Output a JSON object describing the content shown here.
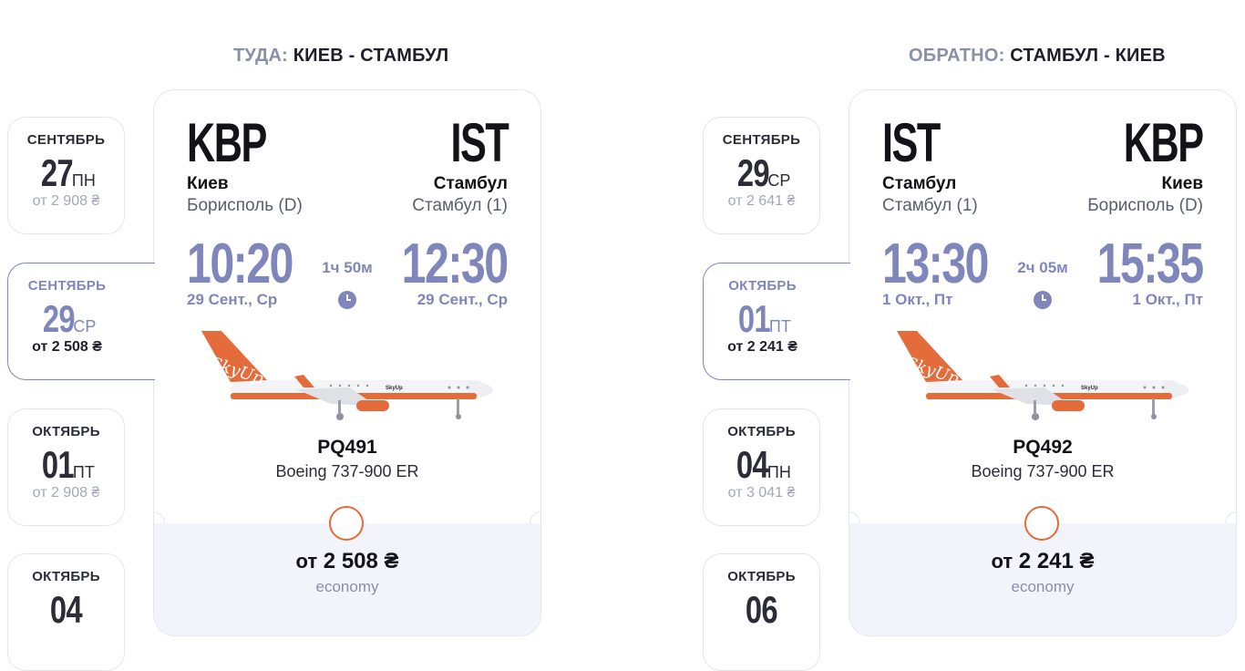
{
  "outbound": {
    "title_prefix": "ТУДА:",
    "title_route": "КИЕВ - СТАМБУЛ",
    "dates": [
      {
        "month": "СЕНТЯБРЬ",
        "day": "27",
        "weekday": "ПН",
        "price": "от 2 908 ₴",
        "active": false
      },
      {
        "month": "СЕНТЯБРЬ",
        "day": "29",
        "weekday": "СР",
        "price": "от 2 508 ₴",
        "active": true
      },
      {
        "month": "ОКТЯБРЬ",
        "day": "01",
        "weekday": "ПТ",
        "price": "от 2 908 ₴",
        "active": false
      },
      {
        "month": "ОКТЯБРЬ",
        "day": "04",
        "weekday": "",
        "price": "",
        "active": false
      }
    ],
    "flight": {
      "from_code": "KBP",
      "from_city": "Киев",
      "from_airport": "Борисполь (D)",
      "to_code": "IST",
      "to_city": "Стамбул",
      "to_airport": "Стамбул (1)",
      "dep_time": "10:20",
      "dep_date": "29 Сент., Ср",
      "arr_time": "12:30",
      "arr_date": "29 Сент., Ср",
      "duration": "1ч 50м",
      "flight_number": "PQ491",
      "aircraft": "Boeing 737-900 ER",
      "price_from": "от",
      "price": "2 508 ₴",
      "fare_class": "economy"
    }
  },
  "return": {
    "title_prefix": "ОБРАТНО:",
    "title_route": "СТАМБУЛ - КИЕВ",
    "dates": [
      {
        "month": "СЕНТЯБРЬ",
        "day": "29",
        "weekday": "СР",
        "price": "от 2 641 ₴",
        "active": false
      },
      {
        "month": "ОКТЯБРЬ",
        "day": "01",
        "weekday": "ПТ",
        "price": "от 2 241 ₴",
        "active": true
      },
      {
        "month": "ОКТЯБРЬ",
        "day": "04",
        "weekday": "ПН",
        "price": "от 3 041 ₴",
        "active": false
      },
      {
        "month": "ОКТЯБРЬ",
        "day": "06",
        "weekday": "",
        "price": "",
        "active": false
      }
    ],
    "flight": {
      "from_code": "IST",
      "from_city": "Стамбул",
      "from_airport": "Стамбул (1)",
      "to_code": "KBP",
      "to_city": "Киев",
      "to_airport": "Борисполь (D)",
      "dep_time": "13:30",
      "dep_date": "1 Окт., Пт",
      "arr_time": "15:35",
      "arr_date": "1 Окт., Пт",
      "duration": "2ч 05м",
      "flight_number": "PQ492",
      "aircraft": "Boeing 737-900 ER",
      "price_from": "от",
      "price": "2 241 ₴",
      "fare_class": "economy"
    }
  },
  "colors": {
    "accent": "#7f86bb",
    "brand_orange": "#e46b3a",
    "fare_bg": "#f1f4fb"
  },
  "airline_livery_text": "SkyUp"
}
